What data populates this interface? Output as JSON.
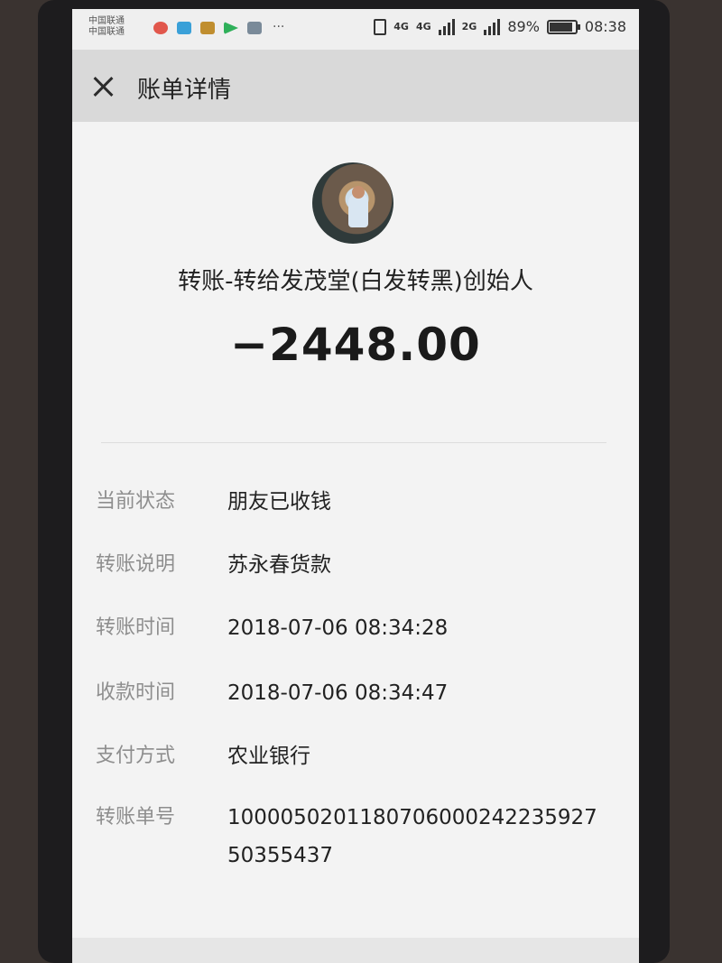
{
  "status_bar": {
    "carrier_1": "中国联通",
    "carrier_2": "中国联通",
    "network_1": "4G",
    "network_2": "4G",
    "network_3": "2G",
    "battery_percent": "89%",
    "battery_level": 0.89,
    "time": "08:38",
    "more": "···"
  },
  "header": {
    "title": "账单详情",
    "close_icon": "close-icon"
  },
  "bill": {
    "payee": "转账-转给发茂堂(白发转黑)创始人",
    "amount": "−2448.00"
  },
  "details": [
    {
      "label": "当前状态",
      "value": "朋友已收钱"
    },
    {
      "label": "转账说明",
      "value": "苏永春货款"
    },
    {
      "label": "转账时间",
      "value": "2018-07-06 08:34:28"
    },
    {
      "label": "收款时间",
      "value": "2018-07-06 08:34:47"
    },
    {
      "label": "支付方式",
      "value": "农业银行"
    },
    {
      "label": "转账单号",
      "value": "1000050201180706000242235927 50355437"
    }
  ]
}
